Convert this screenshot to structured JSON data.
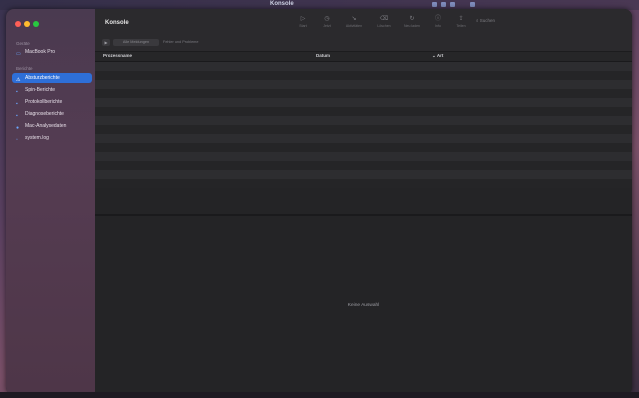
{
  "menubar": {
    "title": "Konsole"
  },
  "window": {
    "title": "Konsole"
  },
  "sidebar": {
    "section_devices": "Geräte",
    "device_item": "MacBook Pro",
    "section_reports": "Berichte",
    "items": [
      {
        "label": "Absturzberichte",
        "icon": "warning-icon",
        "selected": true
      },
      {
        "label": "Spin-Berichte",
        "icon": "document-icon",
        "selected": false
      },
      {
        "label": "Protokollberichte",
        "icon": "document-icon",
        "selected": false
      },
      {
        "label": "Diagnoseberichte",
        "icon": "document-icon",
        "selected": false
      },
      {
        "label": "Mac-Analysedaten",
        "icon": "chart-icon",
        "selected": false
      },
      {
        "label": "system.log",
        "icon": "log-icon",
        "selected": false
      }
    ]
  },
  "toolbar": {
    "buttons": [
      {
        "label": "Start",
        "icon": "play-icon"
      },
      {
        "label": "Jetzt",
        "icon": "clock-icon"
      },
      {
        "label": "Aktivitäten",
        "icon": "activity-icon"
      },
      {
        "label": "Löschen",
        "icon": "trash-icon"
      },
      {
        "label": "Neu laden",
        "icon": "reload-icon"
      },
      {
        "label": "Info",
        "icon": "info-icon"
      },
      {
        "label": "Teilen",
        "icon": "share-icon"
      }
    ],
    "search_placeholder": "Suchen"
  },
  "filterbar": {
    "segment_label": "Alle Meldungen",
    "text": "Fehler und Probleme"
  },
  "table": {
    "columns": [
      "Prozessname",
      "Datum",
      "Art"
    ],
    "row_count": 14
  },
  "detail": {
    "empty_text": "Keine Auswahl"
  },
  "colors": {
    "accent": "#2e6fd8",
    "window_bg": "#242426",
    "sidebar_bg": "#4e3a50"
  }
}
